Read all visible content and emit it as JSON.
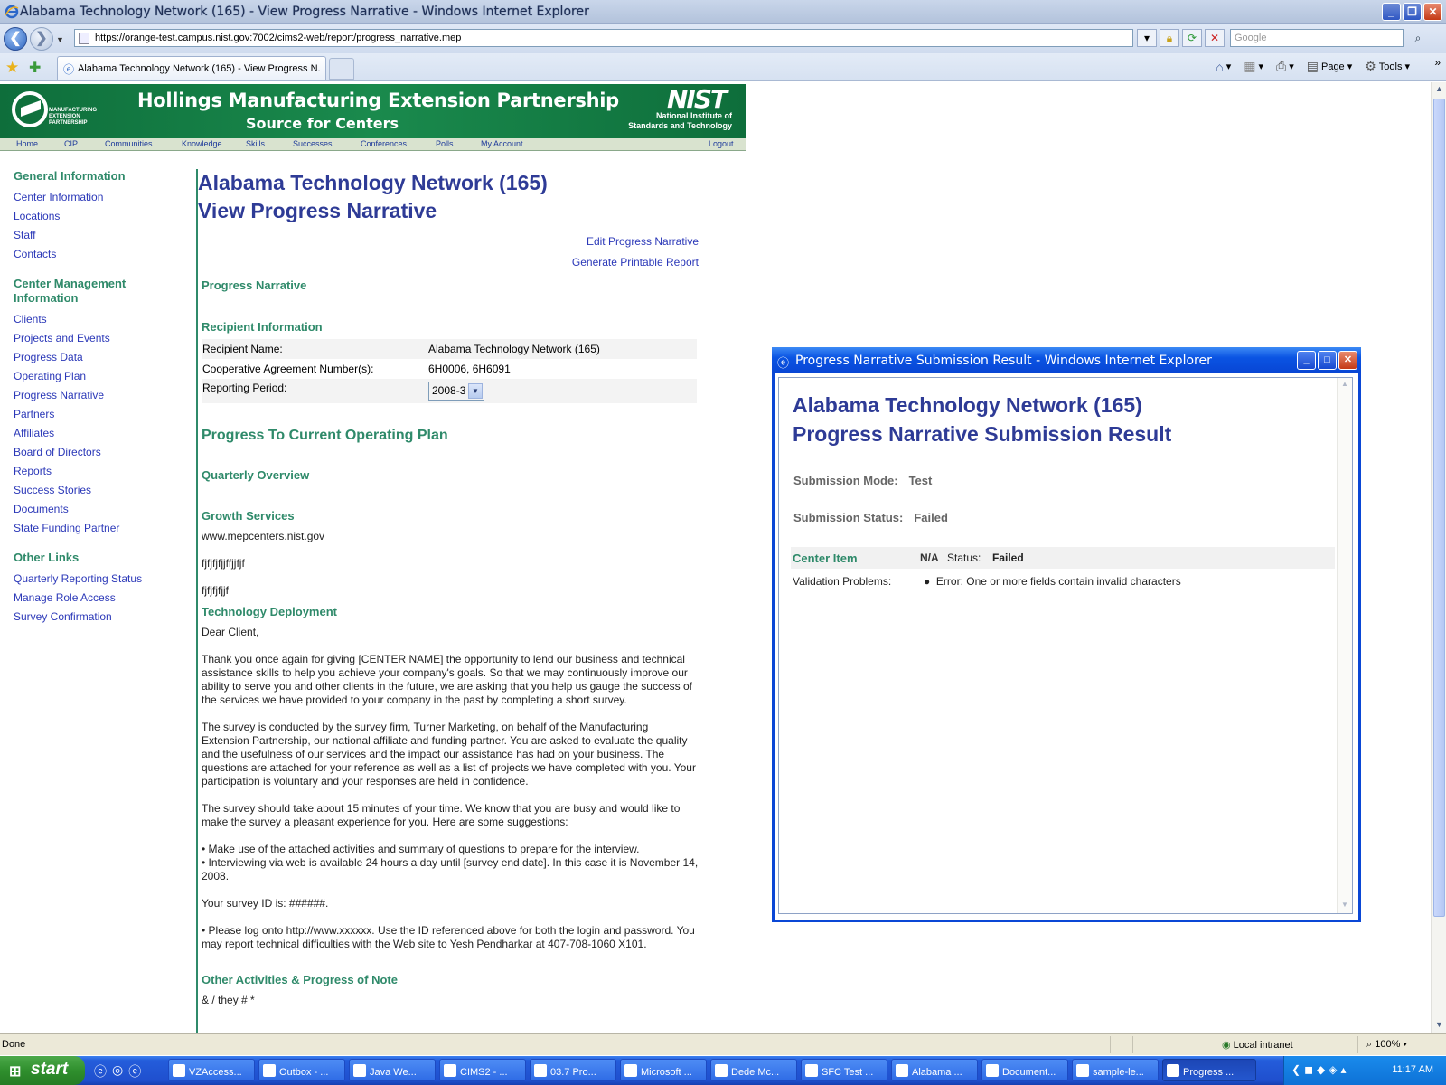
{
  "browser": {
    "title": "Alabama Technology Network (165) - View Progress Narrative - Windows Internet Explorer",
    "url": "https://orange-test.campus.nist.gov:7002/cims2-web/report/progress_narrative.mep",
    "search_placeholder": "Google",
    "tab_label": "Alabama Technology Network (165) - View Progress N...",
    "cmd_page": "Page",
    "cmd_tools": "Tools"
  },
  "banner": {
    "mep_text": "MANUFACTURING EXTENSION PARTNERSHIP",
    "title": "Hollings Manufacturing Extension Partnership",
    "subtitle": "Source for Centers",
    "nist": "NIST",
    "nist_sub": "National Institute of Standards and Technology"
  },
  "topnav": [
    "Home",
    "CIP",
    "Communities",
    "Knowledge",
    "Skills",
    "Successes",
    "Conferences",
    "Polls",
    "My Account",
    "Logout"
  ],
  "leftnav": {
    "general_heading": "General Information",
    "general_items": [
      "Center Information",
      "Locations",
      "Staff",
      "Contacts"
    ],
    "mgmt_heading": "Center Management Information",
    "mgmt_items": [
      "Clients",
      "Projects and Events",
      "Progress Data",
      "Operating Plan",
      "Progress Narrative",
      "Partners",
      "Affiliates",
      "Board of Directors",
      "Reports",
      "Success Stories",
      "Documents",
      "State Funding Partner"
    ],
    "other_heading": "Other Links",
    "other_items": [
      "Quarterly Reporting Status",
      "Manage Role Access",
      "Survey Confirmation"
    ]
  },
  "main": {
    "title_line1": "Alabama Technology Network (165)",
    "title_line2": "View Progress Narrative",
    "edit_link": "Edit Progress Narrative",
    "print_link": "Generate Printable Report",
    "progress_narrative": "Progress Narrative",
    "recipient_heading": "Recipient Information",
    "recipient_name_label": "Recipient Name:",
    "recipient_name_value": "Alabama Technology Network (165)",
    "coop_label": "Cooperative Agreement Number(s):",
    "coop_value": "6H0006, 6H6091",
    "period_label": "Reporting Period:",
    "period_value": "2008-3",
    "progress_heading": "Progress To Current Operating Plan",
    "quarterly_heading": "Quarterly Overview",
    "growth_heading": "Growth Services",
    "growth_url": "www.mepcenters.nist.gov",
    "growth_text1": "fjfjfjfjjffjjfjf",
    "growth_text2": "fjfjfjfjjf",
    "tech_heading": "Technology Deployment",
    "letter": [
      "Dear Client,",
      "Thank you once again for giving [CENTER NAME] the opportunity to lend our business and technical assistance skills to help you achieve your company's goals. So that we may continuously improve our ability to serve you and other clients in the future, we are asking that you help us gauge the success of the services we have provided to your company in the past by completing a short survey.",
      "The survey is conducted by the survey firm, Turner Marketing, on behalf of the Manufacturing Extension Partnership, our national affiliate and funding partner. You are asked to evaluate the quality and the usefulness of our services and the impact our assistance has had on your business. The questions are attached for your reference as well as a list of projects we have completed with you. Your participation is voluntary and your responses are held in confidence.",
      "The survey should take about 15 minutes of your time. We know that you are busy and would like to make the survey a pleasant experience for you. Here are some suggestions:",
      "• Make use of the attached activities and summary of questions to prepare for the interview.\n• Interviewing via web is available 24 hours a day until [survey end date]. In this case it is November 14, 2008.",
      "Your survey ID is: ######.",
      "• Please log onto http://www.xxxxxx. Use the ID referenced above for both the login and password. You may report technical difficulties with the Web site to Yesh Pendharkar at 407-708-1060 X101."
    ],
    "other_heading": "Other Activities & Progress of Note",
    "other_text": "& / they # *"
  },
  "popup": {
    "window_title": "Progress Narrative Submission Result - Windows Internet Explorer",
    "title_line1": "Alabama Technology Network (165)",
    "title_line2": "Progress Narrative Submission Result",
    "mode_label": "Submission Mode:",
    "mode_value": "Test",
    "status_label": "Submission Status:",
    "status_value": "Failed",
    "center_item_label": "Center Item",
    "center_item_value": "N/A",
    "item_status_label": "Status:",
    "item_status_value": "Failed",
    "validation_label": "Validation Problems:",
    "validation_error": "Error: One or more fields contain invalid characters"
  },
  "statusbar": {
    "left": "Done",
    "zone": "Local intranet",
    "zoom": "100%"
  },
  "taskbar": {
    "start": "start",
    "buttons": [
      "VZAccess...",
      "Outbox - ...",
      "Java We...",
      "CIMS2 - ...",
      "03.7  Pro...",
      "Microsoft ...",
      "Dede Mc...",
      "SFC Test ...",
      "Alabama ...",
      "Document...",
      "sample-le...",
      "Progress ..."
    ],
    "clock": "11:17 AM"
  }
}
